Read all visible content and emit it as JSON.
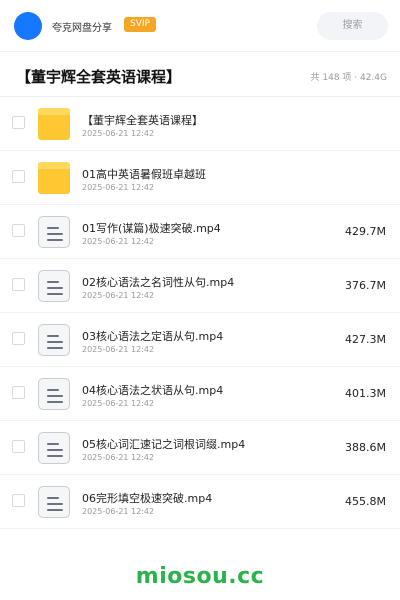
{
  "header": {
    "app_name": "夸克网盘分享",
    "badge": "SVIP",
    "search_label": "搜索"
  },
  "share": {
    "title": "【董宇辉全套英语课程】",
    "summary": "共 148 项 · 42.4G"
  },
  "files": [
    {
      "type": "folder",
      "name": "【董宇辉全套英语课程】",
      "date": "2025-06-21 12:42",
      "size": ""
    },
    {
      "type": "folder",
      "name": "01高中英语暑假班卓越班",
      "date": "2025-06-21 12:42",
      "size": ""
    },
    {
      "type": "video",
      "name": "01写作(谋篇)极速突破.mp4",
      "date": "2025-06-21 12:42",
      "size": "429.7M"
    },
    {
      "type": "video",
      "name": "02核心语法之名词性从句.mp4",
      "date": "2025-06-21 12:42",
      "size": "376.7M"
    },
    {
      "type": "video",
      "name": "03核心语法之定语从句.mp4",
      "date": "2025-06-21 12:42",
      "size": "427.3M"
    },
    {
      "type": "video",
      "name": "04核心语法之状语从句.mp4",
      "date": "2025-06-21 12:42",
      "size": "401.3M"
    },
    {
      "type": "video",
      "name": "05核心词汇速记之词根词缀.mp4",
      "date": "2025-06-21 12:42",
      "size": "388.6M"
    },
    {
      "type": "video",
      "name": "06完形填空极速突破.mp4",
      "date": "2025-06-21 12:42",
      "size": "455.8M"
    }
  ],
  "footer": {
    "watermark": "miosou.cc"
  },
  "colors": {
    "avatar": "#1677ff",
    "badge": "#f5a623",
    "folder": "#ffc832",
    "watermark": "#2bb24c"
  }
}
